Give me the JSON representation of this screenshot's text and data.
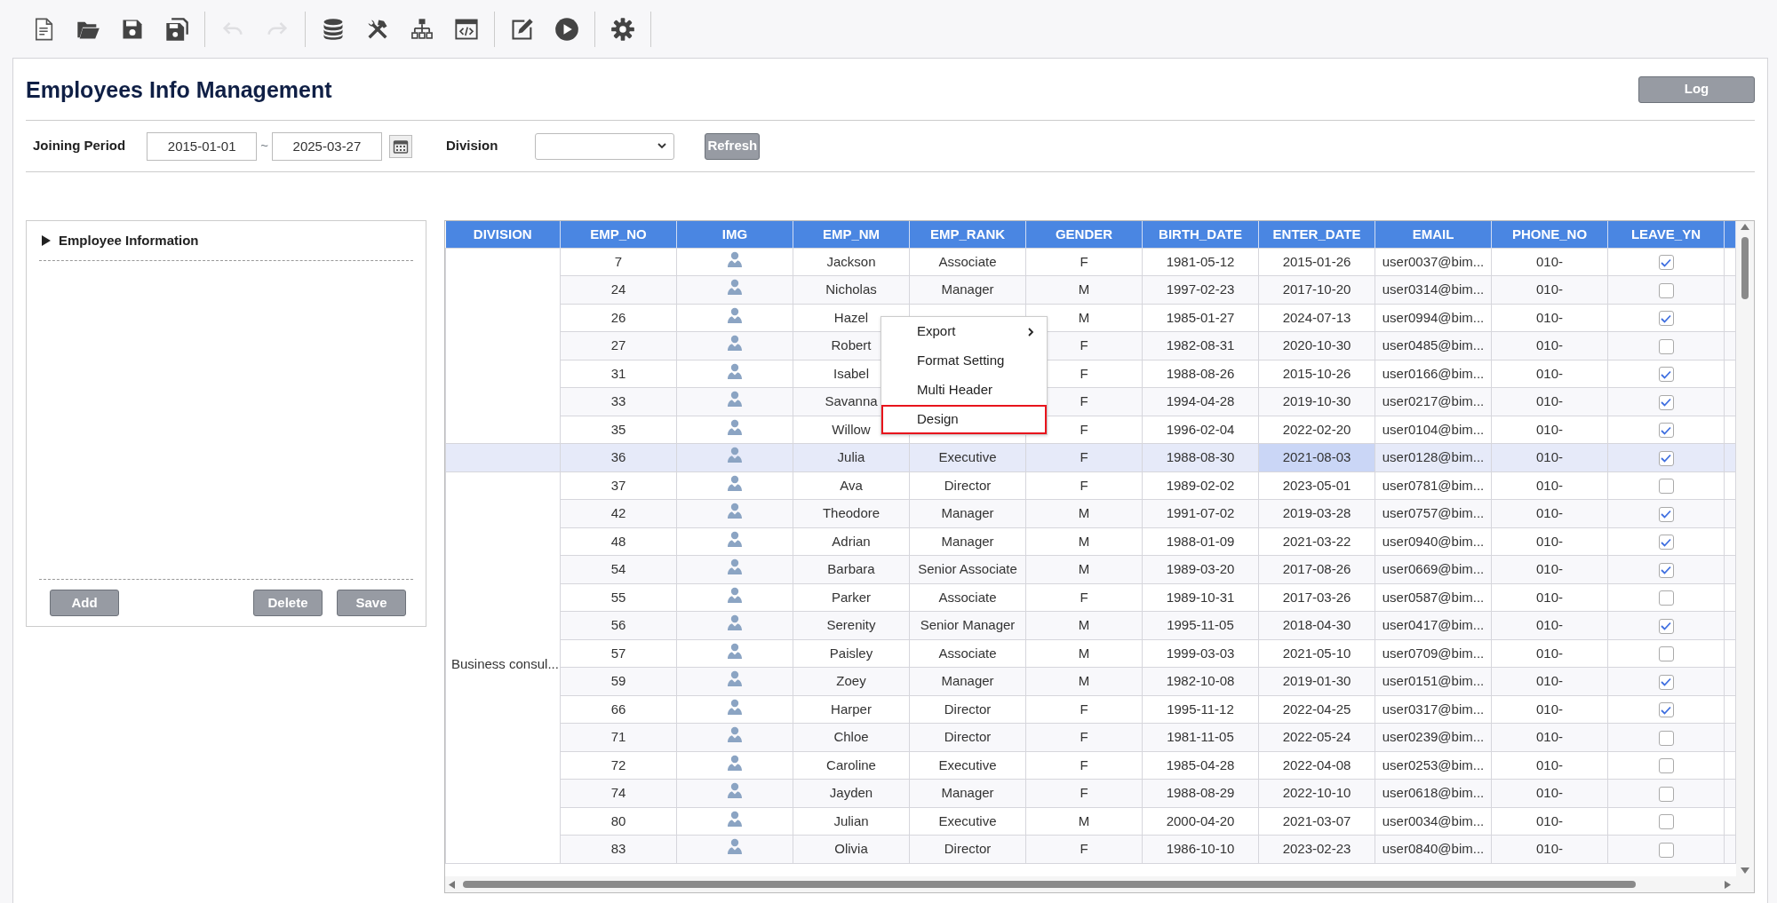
{
  "toolbar": {
    "groups": [
      {
        "items": [
          {
            "kind": "new",
            "disabled": false
          },
          {
            "kind": "open",
            "disabled": false
          },
          {
            "kind": "save",
            "disabled": false
          },
          {
            "kind": "save-all",
            "disabled": false
          }
        ]
      },
      {
        "items": [
          {
            "kind": "undo",
            "disabled": true
          },
          {
            "kind": "redo",
            "disabled": true
          }
        ]
      },
      {
        "items": [
          {
            "kind": "database",
            "disabled": false
          },
          {
            "kind": "tools",
            "disabled": false
          },
          {
            "kind": "hierarchy",
            "disabled": false
          },
          {
            "kind": "code",
            "disabled": false
          }
        ]
      },
      {
        "items": [
          {
            "kind": "edit",
            "disabled": false
          },
          {
            "kind": "run",
            "disabled": false
          }
        ]
      },
      {
        "items": [
          {
            "kind": "settings",
            "disabled": false
          }
        ]
      }
    ]
  },
  "page": {
    "title": "Employees Info Management",
    "log_button": "Log"
  },
  "filters": {
    "period_label": "Joining Period",
    "from": "2015-01-01",
    "separator": "~",
    "to": "2025-03-27",
    "division_label": "Division",
    "refresh_button": "Refresh"
  },
  "detail_panel": {
    "title": "Employee Information",
    "expanded": false,
    "buttons": [
      "Add",
      "Delete",
      "Save"
    ]
  },
  "grid": {
    "columns": [
      "DIVISION",
      "EMP_NO",
      "IMG",
      "EMP_NM",
      "EMP_RANK",
      "GENDER",
      "BIRTH_DATE",
      "ENTER_DATE",
      "EMAIL",
      "PHONE_NO",
      "LEAVE_YN"
    ],
    "groups": [
      {
        "rows": [
          {
            "emp_no": "7",
            "name": "Jackson",
            "rank": "Associate",
            "gender": "F",
            "birth_date": "1981-05-12",
            "enter_date": "2015-01-26",
            "email": "user0037@bim...",
            "phone_no": "010-",
            "leave": true,
            "selected": false,
            "cell_focused": false
          },
          {
            "emp_no": "24",
            "name": "Nicholas",
            "rank": "Manager",
            "gender": "M",
            "birth_date": "1997-02-23",
            "enter_date": "2017-10-20",
            "email": "user0314@bim...",
            "phone_no": "010-",
            "leave": false,
            "selected": false,
            "cell_focused": false
          },
          {
            "emp_no": "26",
            "name": "Hazel",
            "gender": "M",
            "birth_date": "1985-01-27",
            "enter_date": "2024-07-13",
            "email": "user0994@bim...",
            "phone_no": "010-",
            "leave": true,
            "selected": false,
            "cell_focused": false
          },
          {
            "emp_no": "27",
            "name": "Robert",
            "gender": "F",
            "birth_date": "1982-08-31",
            "enter_date": "2020-10-30",
            "email": "user0485@bim...",
            "phone_no": "010-",
            "leave": false,
            "selected": false,
            "cell_focused": false
          },
          {
            "emp_no": "31",
            "name": "Isabel",
            "gender": "F",
            "birth_date": "1988-08-26",
            "enter_date": "2015-10-26",
            "email": "user0166@bim...",
            "phone_no": "010-",
            "leave": true,
            "selected": false,
            "cell_focused": false
          },
          {
            "emp_no": "33",
            "name": "Savanna",
            "gender": "F",
            "birth_date": "1994-04-28",
            "enter_date": "2019-10-30",
            "email": "user0217@bim...",
            "phone_no": "010-",
            "leave": true,
            "selected": false,
            "cell_focused": false
          },
          {
            "emp_no": "35",
            "name": "Willow",
            "gender": "F",
            "birth_date": "1996-02-04",
            "enter_date": "2022-02-20",
            "email": "user0104@bim...",
            "phone_no": "010-",
            "leave": true,
            "selected": false,
            "cell_focused": false
          }
        ]
      },
      {
        "rows": [
          {
            "emp_no": "36",
            "name": "Julia",
            "rank": "Executive",
            "gender": "F",
            "birth_date": "1988-08-30",
            "enter_date": "2021-08-03",
            "email": "user0128@bim...",
            "phone_no": "010-",
            "leave": true,
            "selected": true,
            "cell_focused": true
          }
        ]
      },
      {
        "division": "Business consul...",
        "rows": [
          {
            "emp_no": "37",
            "name": "Ava",
            "rank": "Director",
            "gender": "F",
            "birth_date": "1989-02-02",
            "enter_date": "2023-05-01",
            "email": "user0781@bim...",
            "phone_no": "010-",
            "leave": false,
            "selected": false,
            "cell_focused": false
          },
          {
            "emp_no": "42",
            "name": "Theodore",
            "rank": "Manager",
            "gender": "M",
            "birth_date": "1991-07-02",
            "enter_date": "2019-03-28",
            "email": "user0757@bim...",
            "phone_no": "010-",
            "leave": true,
            "selected": false,
            "cell_focused": false
          },
          {
            "emp_no": "48",
            "name": "Adrian",
            "rank": "Manager",
            "gender": "M",
            "birth_date": "1988-01-09",
            "enter_date": "2021-03-22",
            "email": "user0940@bim...",
            "phone_no": "010-",
            "leave": true,
            "selected": false,
            "cell_focused": false
          },
          {
            "emp_no": "54",
            "name": "Barbara",
            "rank": "Senior Associate",
            "gender": "M",
            "birth_date": "1989-03-20",
            "enter_date": "2017-08-26",
            "email": "user0669@bim...",
            "phone_no": "010-",
            "leave": true,
            "selected": false,
            "cell_focused": false
          },
          {
            "emp_no": "55",
            "name": "Parker",
            "rank": "Associate",
            "gender": "F",
            "birth_date": "1989-10-31",
            "enter_date": "2017-03-26",
            "email": "user0587@bim...",
            "phone_no": "010-",
            "leave": false,
            "selected": false,
            "cell_focused": false
          },
          {
            "emp_no": "56",
            "name": "Serenity",
            "rank": "Senior Manager",
            "gender": "M",
            "birth_date": "1995-11-05",
            "enter_date": "2018-04-30",
            "email": "user0417@bim...",
            "phone_no": "010-",
            "leave": true,
            "selected": false,
            "cell_focused": false
          },
          {
            "emp_no": "57",
            "name": "Paisley",
            "rank": "Associate",
            "gender": "M",
            "birth_date": "1999-03-03",
            "enter_date": "2021-05-10",
            "email": "user0709@bim...",
            "phone_no": "010-",
            "leave": false,
            "selected": false,
            "cell_focused": false
          },
          {
            "emp_no": "59",
            "name": "Zoey",
            "rank": "Manager",
            "gender": "M",
            "birth_date": "1982-10-08",
            "enter_date": "2019-01-30",
            "email": "user0151@bim...",
            "phone_no": "010-",
            "leave": true,
            "selected": false,
            "cell_focused": false
          },
          {
            "emp_no": "66",
            "name": "Harper",
            "rank": "Director",
            "gender": "F",
            "birth_date": "1995-11-12",
            "enter_date": "2022-04-25",
            "email": "user0317@bim...",
            "phone_no": "010-",
            "leave": true,
            "selected": false,
            "cell_focused": false
          },
          {
            "emp_no": "71",
            "name": "Chloe",
            "rank": "Director",
            "gender": "F",
            "birth_date": "1981-11-05",
            "enter_date": "2022-05-24",
            "email": "user0239@bim...",
            "phone_no": "010-",
            "leave": false,
            "selected": false,
            "cell_focused": false
          },
          {
            "emp_no": "72",
            "name": "Caroline",
            "rank": "Executive",
            "gender": "F",
            "birth_date": "1985-04-28",
            "enter_date": "2022-04-08",
            "email": "user0253@bim...",
            "phone_no": "010-",
            "leave": false,
            "selected": false,
            "cell_focused": false
          },
          {
            "emp_no": "74",
            "name": "Jayden",
            "rank": "Manager",
            "gender": "F",
            "birth_date": "1988-08-29",
            "enter_date": "2022-10-10",
            "email": "user0618@bim...",
            "phone_no": "010-",
            "leave": false,
            "selected": false,
            "cell_focused": false
          },
          {
            "emp_no": "80",
            "name": "Julian",
            "rank": "Executive",
            "gender": "M",
            "birth_date": "2000-04-20",
            "enter_date": "2021-03-07",
            "email": "user0034@bim...",
            "phone_no": "010-",
            "leave": false,
            "selected": false,
            "cell_focused": false
          },
          {
            "emp_no": "83",
            "name": "Olivia",
            "rank": "Director",
            "gender": "F",
            "birth_date": "1986-10-10",
            "enter_date": "2023-02-23",
            "email": "user0840@bim...",
            "phone_no": "010-",
            "leave": false,
            "selected": false,
            "cell_focused": false
          }
        ]
      }
    ]
  },
  "context_menu": {
    "items": [
      {
        "label": "Export",
        "has_submenu": true,
        "selected": false
      },
      {
        "label": "Format Setting",
        "has_submenu": false,
        "selected": false
      },
      {
        "label": "Multi Header",
        "has_submenu": false,
        "selected": false
      },
      {
        "label": "Design",
        "has_submenu": false,
        "selected": true
      }
    ]
  }
}
